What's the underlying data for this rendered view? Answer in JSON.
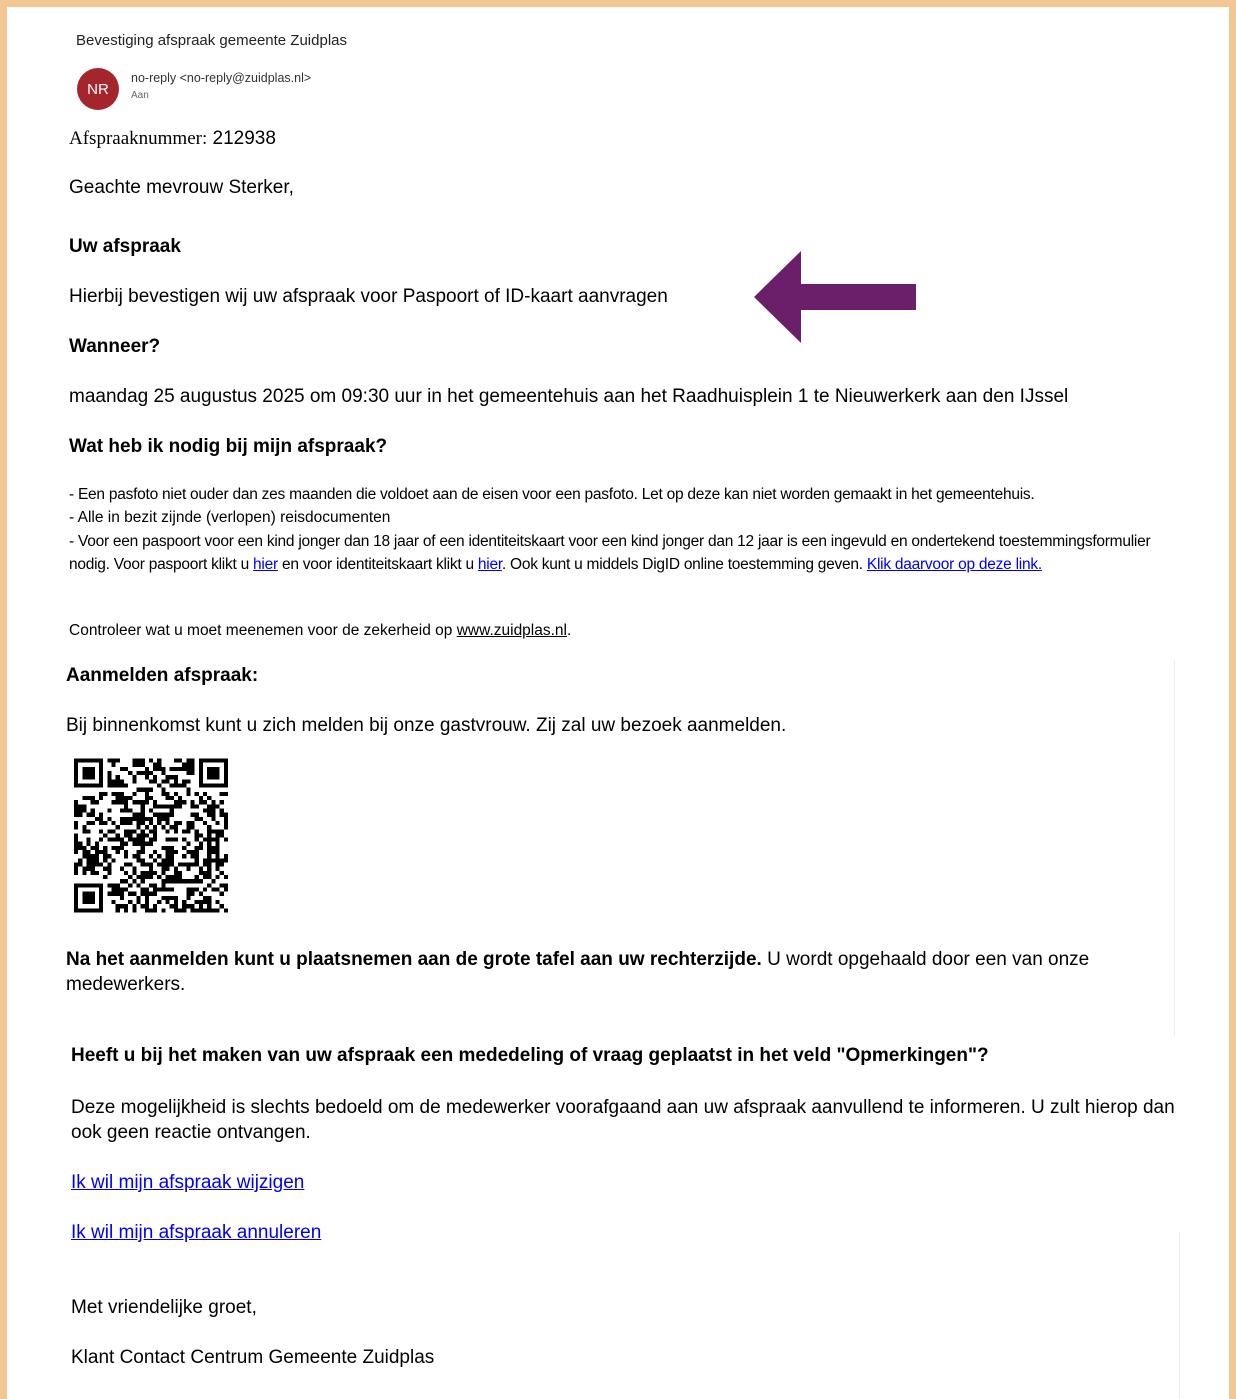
{
  "email": {
    "subject": "Bevestiging afspraak gemeente Zuidplas",
    "avatar_initials": "NR",
    "avatar_color": "#a4262c",
    "sender": "no-reply <no-reply@zuidplas.nl>",
    "to_label": "Aan"
  },
  "body": {
    "appointment_number_label": "Afspraaknummer:",
    "appointment_number": "212938",
    "greeting": "Geachte mevrouw Sterker,",
    "section_appointment": "Uw afspraak",
    "confirmation": "Hierbij bevestigen wij uw afspraak voor Paspoort of ID-kaart aanvragen",
    "section_when": "Wanneer?",
    "when_text": "maandag 25 augustus 2025 om 09:30 uur in het gemeentehuis aan het Raadhuisplein 1 te Nieuwerkerk aan den IJssel",
    "section_needs": "Wat heb ik nodig bij mijn afspraak?",
    "needs_1": "- Een pasfoto niet ouder dan zes maanden die voldoet aan de eisen voor een pasfoto. Let op deze kan niet worden gemaakt in het gemeentehuis.",
    "needs_2": "- Alle in bezit zijnde (verlopen) reisdocumenten",
    "needs_3a": "- Voor een paspoort voor een kind jonger dan 18 jaar of een identiteitskaart voor een kind jonger dan 12 jaar is een ingevuld en ondertekend toestemmingsformulier nodig. Voor paspoort klikt u ",
    "needs_3_link1": "hier",
    "needs_3b": " en voor identiteitskaart klikt u ",
    "needs_3_link2": "hier",
    "needs_3c": ". Ook kunt u middels DigID online toestemming geven. ",
    "needs_3_link3": "Klik daarvoor op deze link.",
    "check_text": "Controleer wat u moet meenemen voor de zekerheid op ",
    "check_link": "www.zuidplas.nl",
    "check_end": ".",
    "section_checkin": "Aanmelden afspraak:",
    "checkin_text": "Bij binnenkomst kunt u zich melden bij onze gastvrouw. Zij zal uw bezoek aanmelden.",
    "after_bold": "Na het aanmelden kunt u plaatsnemen aan de grote tafel aan uw rechterzijde.",
    "after_rest": " U wordt opgehaald door een van onze medewerkers.",
    "section_remarks": "Heeft u bij het maken van uw afspraak een mededeling of vraag geplaatst in het veld \"Opmerkingen\"?",
    "remarks_text": "Deze mogelijkheid is slechts bedoeld om de medewerker voorafgaand aan uw afspraak aanvullend te informeren. U zult hierop dan ook geen reactie ontvangen.",
    "link_change": "Ik wil mijn afspraak wijzigen",
    "link_cancel": "Ik wil mijn afspraak annuleren",
    "closing": "Met vriendelijke groet,",
    "signature": "Klant Contact Centrum Gemeente Zuidplas"
  },
  "annotation": {
    "arrow_color": "#6b1f6b",
    "arrow_icon": "arrow-left-icon"
  },
  "colors": {
    "frame_border": "#f2c794",
    "link": "#0000ee"
  }
}
